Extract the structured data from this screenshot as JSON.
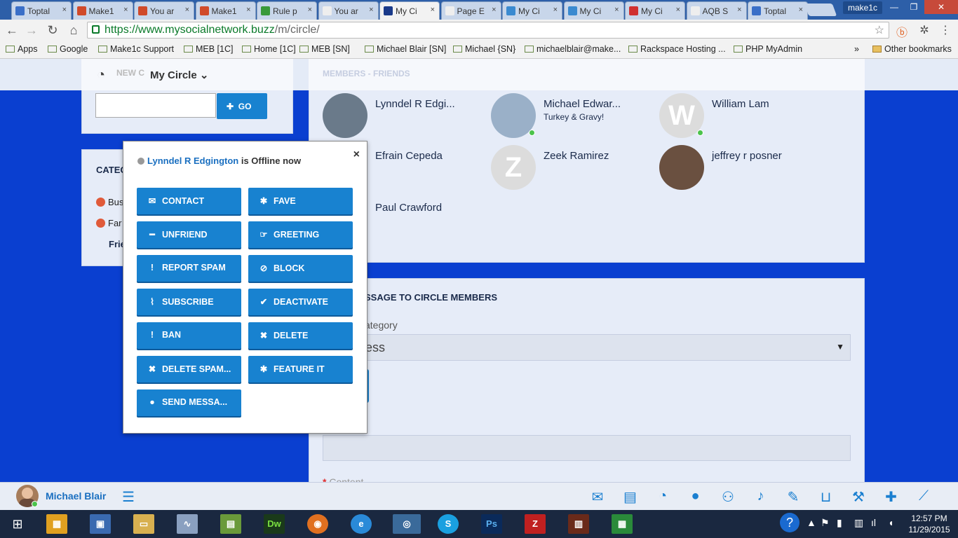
{
  "browser": {
    "tabs": [
      {
        "title": "Toptal",
        "color": "#3a6fc8"
      },
      {
        "title": "Make1",
        "color": "#d04a2a"
      },
      {
        "title": "You ar",
        "color": "#d04a2a"
      },
      {
        "title": "Make1",
        "color": "#d04a2a"
      },
      {
        "title": "Rule p",
        "color": "#3a9a3a"
      },
      {
        "title": "You ar",
        "color": "#eeeeee"
      },
      {
        "title": "My Ci",
        "color": "#1a3a8a"
      },
      {
        "title": "Page E",
        "color": "#eeeeee"
      },
      {
        "title": "My Ci",
        "color": "#3a8ad0"
      },
      {
        "title": "My Ci",
        "color": "#3a8ad0"
      },
      {
        "title": "My Ci",
        "color": "#d03030"
      },
      {
        "title": "AQB S",
        "color": "#eeeeee"
      },
      {
        "title": "Toptal",
        "color": "#3a6fc8"
      }
    ],
    "active_tab_index": 6,
    "profile": "make1c",
    "url_scheme_host": "https://www.mysocialnetwork.buzz",
    "url_path": "/m/circle/",
    "bookmarks": [
      "Apps",
      "Google",
      "Make1c Support",
      "MEB [1C]",
      "Home [1C]",
      "MEB [SN]",
      "Michael Blair [SN]",
      "Michael {SN}",
      "michaelblair@make...",
      "Rackspace Hosting ...",
      "PHP MyAdmin"
    ],
    "bookmarks_more": "»",
    "other_bookmarks": "Other bookmarks"
  },
  "circle": {
    "faded_label": "NEW C",
    "title": "My Circle",
    "go_label": "GO"
  },
  "categories": {
    "heading": "CATEG",
    "items": [
      "Bus",
      "Far",
      "Frie"
    ]
  },
  "members": {
    "heading": "MEMBERS - FRIENDS",
    "list": [
      {
        "name": "Lynndel R Edgi...",
        "sub": "",
        "letter": "",
        "online": false,
        "avatar_color": "#6a7a8a"
      },
      {
        "name": "Michael Edwar...",
        "sub": "Turkey & Gravy!",
        "letter": "",
        "online": true,
        "avatar_color": "#9ab0c8"
      },
      {
        "name": "William Lam",
        "sub": "",
        "letter": "W",
        "online": true,
        "avatar_color": "#dcdcdc"
      },
      {
        "name": "Efrain Cepeda",
        "sub": "",
        "letter": "",
        "online": false,
        "avatar_color": "#cfd6e3"
      },
      {
        "name": "Zeek Ramirez",
        "sub": "",
        "letter": "Z",
        "online": false,
        "avatar_color": "#dcdcdc"
      },
      {
        "name": "jeffrey r posner",
        "sub": "",
        "letter": "",
        "online": false,
        "avatar_color": "#6a5040"
      },
      {
        "name": "Paul Crawford",
        "sub": "",
        "letter": "",
        "online": false,
        "avatar_color": "#cfd6e3"
      }
    ]
  },
  "message": {
    "title": "SSAGE TO CIRCLE MEMBERS",
    "category_label": "ategory",
    "category_value": "ess",
    "content_label": "Content",
    "required_mark": "*"
  },
  "popup": {
    "user_name": "Lynndel R Edgington",
    "status_text": " is Offline now",
    "close": "×",
    "buttons": [
      {
        "label": "CONTACT",
        "icon": "✉"
      },
      {
        "label": "FAVE",
        "icon": "✱"
      },
      {
        "label": "UNFRIEND",
        "icon": "━"
      },
      {
        "label": "GREETING",
        "icon": "☞"
      },
      {
        "label": "REPORT SPAM",
        "icon": "!"
      },
      {
        "label": "BLOCK",
        "icon": "⊘"
      },
      {
        "label": "SUBSCRIBE",
        "icon": "⌇"
      },
      {
        "label": "DEACTIVATE",
        "icon": "✔"
      },
      {
        "label": "BAN",
        "icon": "!"
      },
      {
        "label": "DELETE",
        "icon": "✖"
      },
      {
        "label": "DELETE SPAM...",
        "icon": "✖"
      },
      {
        "label": "FEATURE IT",
        "icon": "✱"
      },
      {
        "label": "SEND MESSA...",
        "icon": "●"
      }
    ]
  },
  "bottom_bar": {
    "user_name": "Michael Blair",
    "icons": [
      "envelope-icon",
      "newspaper-icon",
      "dashboard-icon",
      "user-icon",
      "users-icon",
      "bell-icon",
      "comments-icon",
      "cart-icon",
      "wrench-icon",
      "plus-icon",
      "magic-wand-icon"
    ]
  },
  "taskbar": {
    "time": "12:57 PM",
    "date": "11/29/2015"
  }
}
